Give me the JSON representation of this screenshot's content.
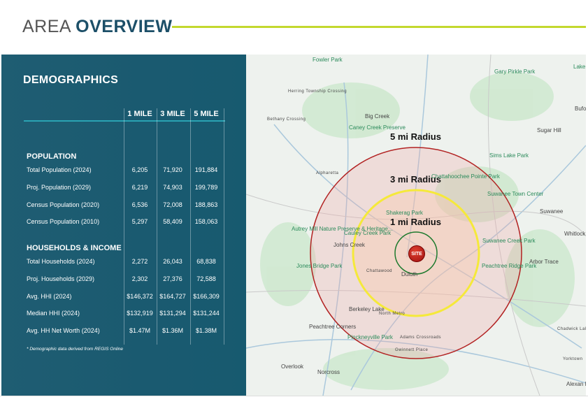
{
  "header": {
    "title_light": "AREA ",
    "title_bold": "OVERVIEW"
  },
  "demographics": {
    "title": "DEMOGRAPHICS",
    "columns": [
      "1 MILE",
      "3 MILE",
      "5 MILE"
    ],
    "sections": [
      {
        "name": "POPULATION",
        "rows": [
          {
            "label": "Total Population (2024)",
            "values": [
              "6,205",
              "71,920",
              "191,884"
            ]
          },
          {
            "label": "Proj. Population (2029)",
            "values": [
              "6,219",
              "74,903",
              "199,789"
            ]
          },
          {
            "label": "Census Population (2020)",
            "values": [
              "6,536",
              "72,008",
              "188,863"
            ]
          },
          {
            "label": "Census Population (2010)",
            "values": [
              "5,297",
              "58,409",
              "158,063"
            ]
          }
        ]
      },
      {
        "name": "HOUSEHOLDS & INCOME",
        "rows": [
          {
            "label": "Total Households (2024)",
            "values": [
              "2,272",
              "26,043",
              "68,838"
            ]
          },
          {
            "label": "Proj. Households (2029)",
            "values": [
              "2,302",
              "27,376",
              "72,588"
            ]
          },
          {
            "label": "Avg. HHI (2024)",
            "values": [
              "$146,372",
              "$164,727",
              "$166,309"
            ]
          },
          {
            "label": "Median HHI (2024)",
            "values": [
              "$132,919",
              "$131,294",
              "$131,244"
            ]
          },
          {
            "label": "Avg. HH Net Worth (2024)",
            "values": [
              "$1.47M",
              "$1.36M",
              "$1.38M"
            ]
          }
        ]
      }
    ],
    "note": "* Demographic data derived from REGIS Online"
  },
  "map": {
    "radius_labels": [
      "5 mi Radius",
      "3 mi Radius",
      "1 mi Radius"
    ],
    "site_label": "SITE",
    "colors": {
      "r5": "#b22222",
      "r3": "#f5e93a",
      "r1": "#1e7a2e"
    },
    "places": [
      "Fowler Park",
      "Gary Pirkle Park",
      "Big Creek",
      "Caney Creek Preserve",
      "Sugar Hill",
      "Sims Lake Park",
      "Chattahoochee Pointe Park",
      "Suwanee Town Center",
      "Suwanee",
      "Shakerag Park",
      "Cauley Creek Park",
      "Johns Creek",
      "Suwanee Creek Park",
      "Peachtree Ridge Park",
      "Arbor Trace",
      "Duluth",
      "Chattawood",
      "Berkeley Lake",
      "North Metro",
      "Peachtree Corners",
      "Pinckneyville Park",
      "Adams Crossroads",
      "Gwinnett Place",
      "Norcross",
      "Overlook",
      "Autrey Mill Nature Preserve & Heritage...",
      "Jones Bridge Park",
      "Alpharetta",
      "Herring Township Crossing",
      "Bethany Crossing",
      "Whitlock Farms",
      "Chadwick Lake",
      "Yorktown",
      "Alexan Park",
      "Buford",
      "Lake"
    ]
  }
}
